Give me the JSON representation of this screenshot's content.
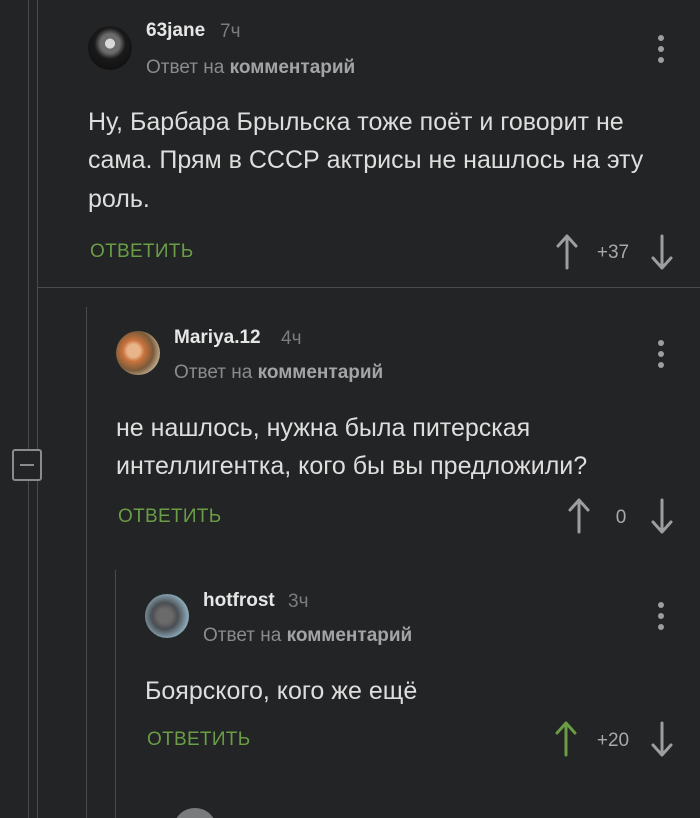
{
  "comments": [
    {
      "author": "63jane",
      "time": "7ч",
      "reply_prefix": "Ответ на",
      "reply_target": "комментарий",
      "text": "Ну, Барбара Брыльска тоже поёт и говорит не сама. Прям в СССР актрисы не нашлось на эту роль.",
      "reply_label": "ОТВЕТИТЬ",
      "score": "+37",
      "upvoted": false
    },
    {
      "author": "Mariya.12",
      "time": "4ч",
      "reply_prefix": "Ответ на",
      "reply_target": "комментарий",
      "text": "не нашлось, нужна была питерская интеллигентка, кого бы вы предложили?",
      "reply_label": "ОТВЕТИТЬ",
      "score": "0",
      "upvoted": false
    },
    {
      "author": "hotfrost",
      "time": "3ч",
      "reply_prefix": "Ответ на",
      "reply_target": "комментарий",
      "text": "Боярского, кого же ещё",
      "reply_label": "ОТВЕТИТЬ",
      "score": "+20",
      "upvoted": true
    }
  ],
  "colors": {
    "background": "#232425",
    "reply_green": "#6a9d45",
    "upvote_active": "#6a9d45",
    "arrow_default": "#9d9e9f"
  }
}
